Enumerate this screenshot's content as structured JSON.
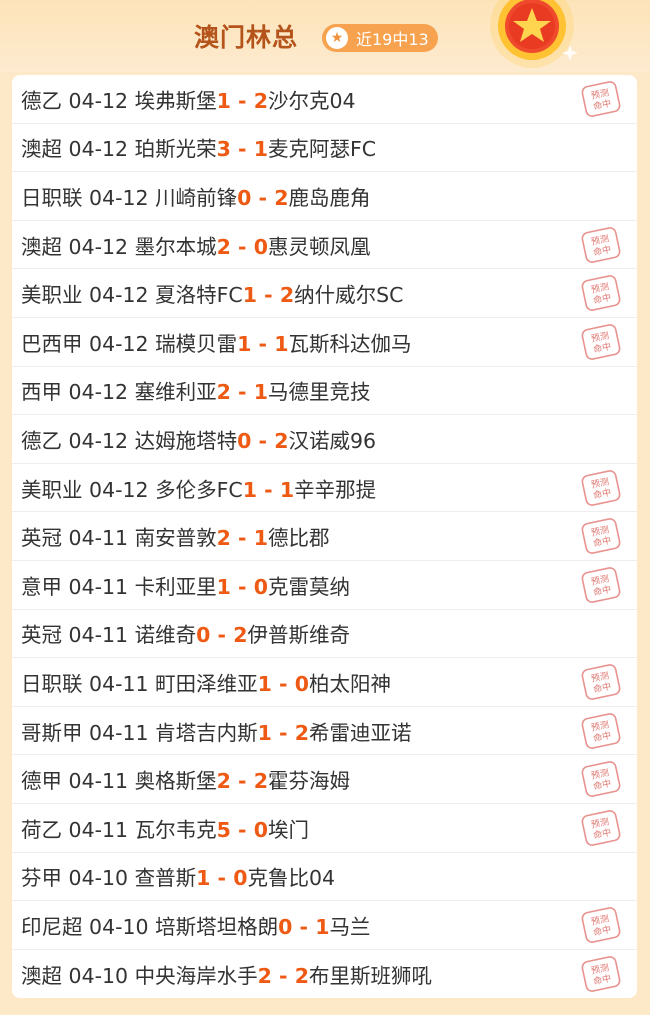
{
  "header": {
    "title": "澳门林总",
    "badge_text": "近19中13"
  },
  "stamp_text": "预测命中",
  "matches": [
    {
      "league": "德乙",
      "date": "04-12",
      "home": "埃弗斯堡",
      "home_score": "1",
      "away_score": "2",
      "away": "沙尔克04",
      "hit": true
    },
    {
      "league": "澳超",
      "date": "04-12",
      "home": "珀斯光荣",
      "home_score": "3",
      "away_score": "1",
      "away": "麦克阿瑟FC",
      "hit": false
    },
    {
      "league": "日职联",
      "date": "04-12",
      "home": "川崎前锋",
      "home_score": "0",
      "away_score": "2",
      "away": "鹿岛鹿角",
      "hit": false
    },
    {
      "league": "澳超",
      "date": "04-12",
      "home": "墨尔本城",
      "home_score": "2",
      "away_score": "0",
      "away": "惠灵顿凤凰",
      "hit": true
    },
    {
      "league": "美职业",
      "date": "04-12",
      "home": "夏洛特FC",
      "home_score": "1",
      "away_score": "2",
      "away": "纳什威尔SC",
      "hit": true
    },
    {
      "league": "巴西甲",
      "date": "04-12",
      "home": "瑞模贝雷",
      "home_score": "1",
      "away_score": "1",
      "away": "瓦斯科达伽马",
      "hit": true
    },
    {
      "league": "西甲",
      "date": "04-12",
      "home": "塞维利亚",
      "home_score": "2",
      "away_score": "1",
      "away": "马德里竞技",
      "hit": false
    },
    {
      "league": "德乙",
      "date": "04-12",
      "home": "达姆施塔特",
      "home_score": "0",
      "away_score": "2",
      "away": "汉诺威96",
      "hit": false
    },
    {
      "league": "美职业",
      "date": "04-12",
      "home": "多伦多FC",
      "home_score": "1",
      "away_score": "1",
      "away": "辛辛那提",
      "hit": true
    },
    {
      "league": "英冠",
      "date": "04-11",
      "home": "南安普敦",
      "home_score": "2",
      "away_score": "1",
      "away": "德比郡",
      "hit": true
    },
    {
      "league": "意甲",
      "date": "04-11",
      "home": "卡利亚里",
      "home_score": "1",
      "away_score": "0",
      "away": "克雷莫纳",
      "hit": true
    },
    {
      "league": "英冠",
      "date": "04-11",
      "home": "诺维奇",
      "home_score": "0",
      "away_score": "2",
      "away": "伊普斯维奇",
      "hit": false
    },
    {
      "league": "日职联",
      "date": "04-11",
      "home": "町田泽维亚",
      "home_score": "1",
      "away_score": "0",
      "away": "柏太阳神",
      "hit": true
    },
    {
      "league": "哥斯甲",
      "date": "04-11",
      "home": "肯塔吉内斯",
      "home_score": "1",
      "away_score": "2",
      "away": "希雷迪亚诺",
      "hit": true
    },
    {
      "league": "德甲",
      "date": "04-11",
      "home": "奥格斯堡",
      "home_score": "2",
      "away_score": "2",
      "away": "霍芬海姆",
      "hit": true
    },
    {
      "league": "荷乙",
      "date": "04-11",
      "home": "瓦尔韦克",
      "home_score": "5",
      "away_score": "0",
      "away": "埃门",
      "hit": true
    },
    {
      "league": "芬甲",
      "date": "04-10",
      "home": "查普斯",
      "home_score": "1",
      "away_score": "0",
      "away": "克鲁比04",
      "hit": false
    },
    {
      "league": "印尼超",
      "date": "04-10",
      "home": "培斯塔坦格朗",
      "home_score": "0",
      "away_score": "1",
      "away": "马兰",
      "hit": true
    },
    {
      "league": "澳超",
      "date": "04-10",
      "home": "中央海岸水手",
      "home_score": "2",
      "away_score": "2",
      "away": "布里斯班狮吼",
      "hit": true
    }
  ]
}
